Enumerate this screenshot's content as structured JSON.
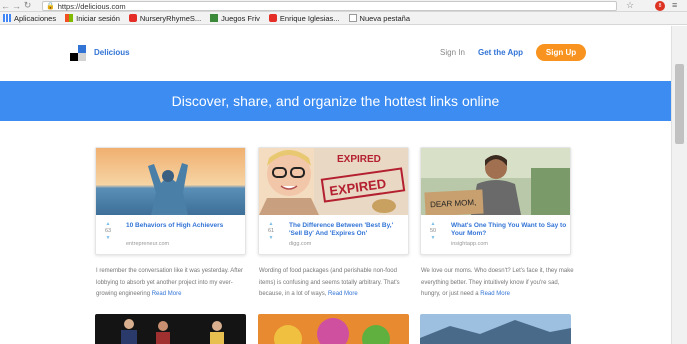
{
  "browser": {
    "url": "https://delicious.com",
    "bookmarks": [
      {
        "label": "Aplicaciones",
        "icon": "apps-icon"
      },
      {
        "label": "Iniciar sesión",
        "icon": "microsoft-icon"
      },
      {
        "label": "NurseryRhymeS...",
        "icon": "youtube-icon"
      },
      {
        "label": "Juegos Friv",
        "icon": "friv-icon"
      },
      {
        "label": "Enrique Iglesias...",
        "icon": "youtube-icon"
      },
      {
        "label": "Nueva pestaña",
        "icon": "page-icon"
      }
    ],
    "extension_badge": "8"
  },
  "header": {
    "brand": "Delicious",
    "signin": "Sign In",
    "getapp": "Get the App",
    "signup": "Sign Up"
  },
  "banner": {
    "text": "Discover, share, and organize the hottest links online"
  },
  "cards": [
    {
      "title": "10 Behaviors of High Achievers",
      "domain": "entrepreneur.com",
      "votes": "63",
      "description": "I remember the conversation like it was yesterday. After lobbying to absorb yet another project into my ever-growing engineering",
      "readmore": "Read More"
    },
    {
      "title": "The Difference Between 'Best By,' 'Sell By' And 'Expires On'",
      "domain": "digg.com",
      "votes": "61",
      "description": "Wording of food packages (and perishable non-food items) is confusing and seems totally arbitrary. That's because, in a lot of ways,",
      "readmore": "Read More"
    },
    {
      "title": "What's One Thing You Want to Say to Your Mom?",
      "domain": "insightapp.com",
      "votes": "50",
      "description": "We love our moms. Who doesn't? Let's face it, they make everything better. They intuitively know if you're sad, hungry, or just need a",
      "readmore": "Read More"
    }
  ],
  "image_text": {
    "stamp_top": "EXPIRED",
    "stamp_main": "EXPIRED",
    "sign": "DEAR MOM,"
  }
}
